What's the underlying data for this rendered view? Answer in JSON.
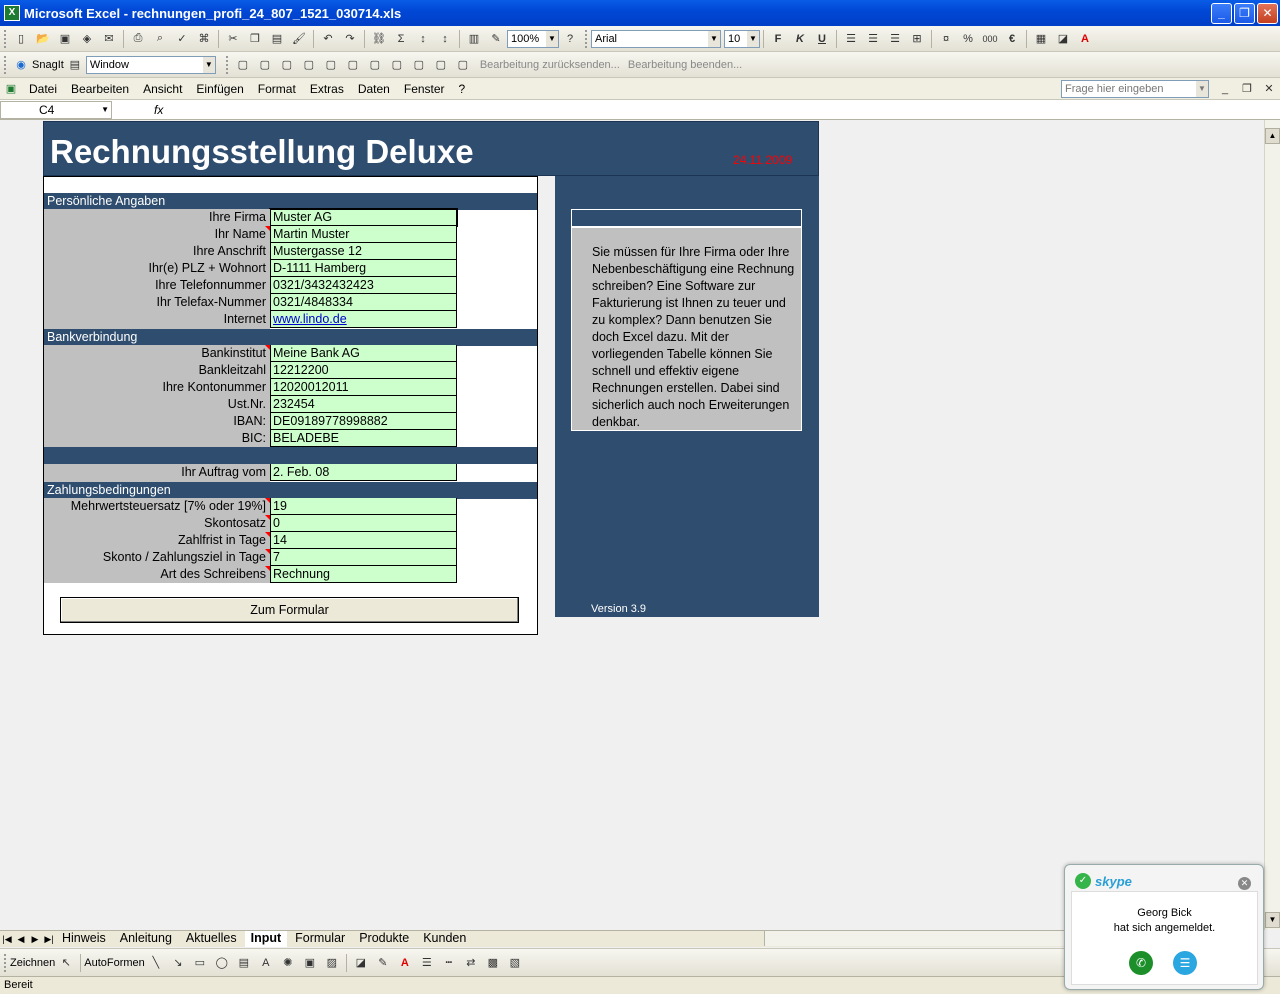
{
  "window": {
    "title": "Microsoft Excel - rechnungen_profi_24_807_1521_030714.xls",
    "min": "_",
    "restore": "❐",
    "close": "✕"
  },
  "toolbar": {
    "zoom": "100%",
    "font": "Arial",
    "size": "10",
    "bold": "F",
    "italic": "K",
    "underline": "U",
    "percent": "%",
    "thousands": "000",
    "euro": "€"
  },
  "snagit": {
    "label": "SnagIt",
    "window_combo": "Window",
    "review1": "Bearbeitung zurücksenden...",
    "review2": "Bearbeitung beenden..."
  },
  "menu": {
    "items": [
      "Datei",
      "Bearbeiten",
      "Ansicht",
      "Einfügen",
      "Format",
      "Extras",
      "Daten",
      "Fenster",
      "?"
    ],
    "help_placeholder": "Frage hier eingeben"
  },
  "formula": {
    "namebox": "C4",
    "fx": "fx"
  },
  "sheet": {
    "title": "Rechnungsstellung Deluxe",
    "date": "24.11.2009",
    "sections": {
      "personal": "Persönliche Angaben",
      "bank": "Bankverbindung",
      "payment": "Zahlungsbedingungen"
    },
    "personal_rows": [
      {
        "label": "Ihre Firma",
        "value": "Muster AG"
      },
      {
        "label": "Ihr Name",
        "value": "Martin Muster"
      },
      {
        "label": "Ihre Anschrift",
        "value": "Mustergasse 12"
      },
      {
        "label": "Ihr(e) PLZ + Wohnort",
        "value": "D-1111 Hamberg"
      },
      {
        "label": "Ihre Telefonnummer",
        "value": "0321/3432432423"
      },
      {
        "label": "Ihr Telefax-Nummer",
        "value": "0321/4848334"
      },
      {
        "label": "Internet",
        "value": "www.lindo.de"
      }
    ],
    "bank_rows": [
      {
        "label": "Bankinstitut",
        "value": "Meine Bank AG"
      },
      {
        "label": "Bankleitzahl",
        "value": "12212200"
      },
      {
        "label": "Ihre Kontonummer",
        "value": "12020012011"
      },
      {
        "label": "Ust.Nr.",
        "value": "232454"
      },
      {
        "label": "IBAN:",
        "value": "DE09189778998882"
      },
      {
        "label": "BIC:",
        "value": "BELADEBE"
      }
    ],
    "order_row": {
      "label": "Ihr Auftrag vom",
      "value": "2. Feb. 08"
    },
    "payment_rows": [
      {
        "label": "Mehrwertsteuersatz [7% oder 19%]",
        "value": "19"
      },
      {
        "label": "Skontosatz",
        "value": "0"
      },
      {
        "label": "Zahlfrist in Tage",
        "value": "14"
      },
      {
        "label": "Skonto / Zahlungsziel in Tage",
        "value": "7"
      },
      {
        "label": "Art des Schreibens",
        "value": "Rechnung"
      }
    ],
    "button": "Zum Formular",
    "info_text": "Sie müssen für Ihre Firma oder Ihre Nebenbeschäftigung eine Rechnung schreiben? Eine Software zur Fakturierung ist Ihnen zu teuer und zu komplex? Dann benutzen Sie doch Excel dazu. Mit der vorliegenden Tabelle können Sie schnell und effektiv eigene Rechnungen erstellen. Dabei sind sicherlich auch noch Erweiterungen denkbar.",
    "version": "Version 3.9"
  },
  "tabs": [
    "Hinweis",
    "Anleitung",
    "Aktuelles",
    "Input",
    "Formular",
    "Produkte",
    "Kunden"
  ],
  "active_tab": "Input",
  "drawbar": {
    "zeichnen": "Zeichnen",
    "autoformen": "AutoFormen"
  },
  "status": "Bereit",
  "skype": {
    "brand": "skype",
    "user": "Georg Bick",
    "message": "hat sich angemeldet."
  }
}
